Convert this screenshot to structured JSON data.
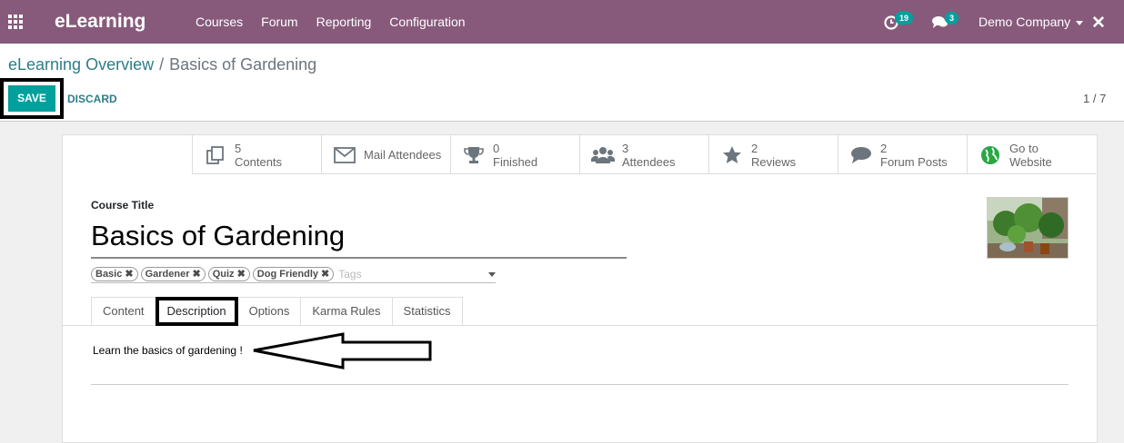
{
  "navbar": {
    "brand": "eLearning",
    "menu": [
      "Courses",
      "Forum",
      "Reporting",
      "Configuration"
    ],
    "activity_count": "19",
    "messages_count": "3",
    "company": "Demo Company",
    "apps_icon": "grid-icon",
    "close_icon": "close-icon"
  },
  "control": {
    "breadcrumb_parent": "eLearning Overview",
    "breadcrumb_sep": "/",
    "breadcrumb_current": "Basics of Gardening",
    "save_label": "SAVE",
    "discard_label": "DISCARD",
    "pager": "1 / 7"
  },
  "stats": [
    {
      "icon": "copy-icon",
      "line1": "5",
      "line2": "Contents"
    },
    {
      "icon": "envelope-icon",
      "line1": "Mail Attendees",
      "line2": ""
    },
    {
      "icon": "trophy-icon",
      "line1": "0",
      "line2": "Finished"
    },
    {
      "icon": "users-icon",
      "line1": "3",
      "line2": "Attendees"
    },
    {
      "icon": "star-icon",
      "line1": "2",
      "line2": "Reviews"
    },
    {
      "icon": "comment-icon",
      "line1": "2",
      "line2": "Forum Posts"
    },
    {
      "icon": "globe-icon",
      "line1": "Go to",
      "line2": "Website"
    }
  ],
  "form": {
    "course_title_label": "Course Title",
    "course_title": "Basics of Gardening",
    "tags": [
      "Basic",
      "Gardener",
      "Quiz",
      "Dog Friendly"
    ],
    "tags_placeholder": "Tags",
    "tabs": [
      "Content",
      "Description",
      "Options",
      "Karma Rules",
      "Statistics"
    ],
    "active_tab": "Description",
    "description": "Learn the basics of gardening !"
  },
  "colors": {
    "navbar": "#875a7b",
    "primary": "#00a09d",
    "link": "#2e7d86"
  }
}
